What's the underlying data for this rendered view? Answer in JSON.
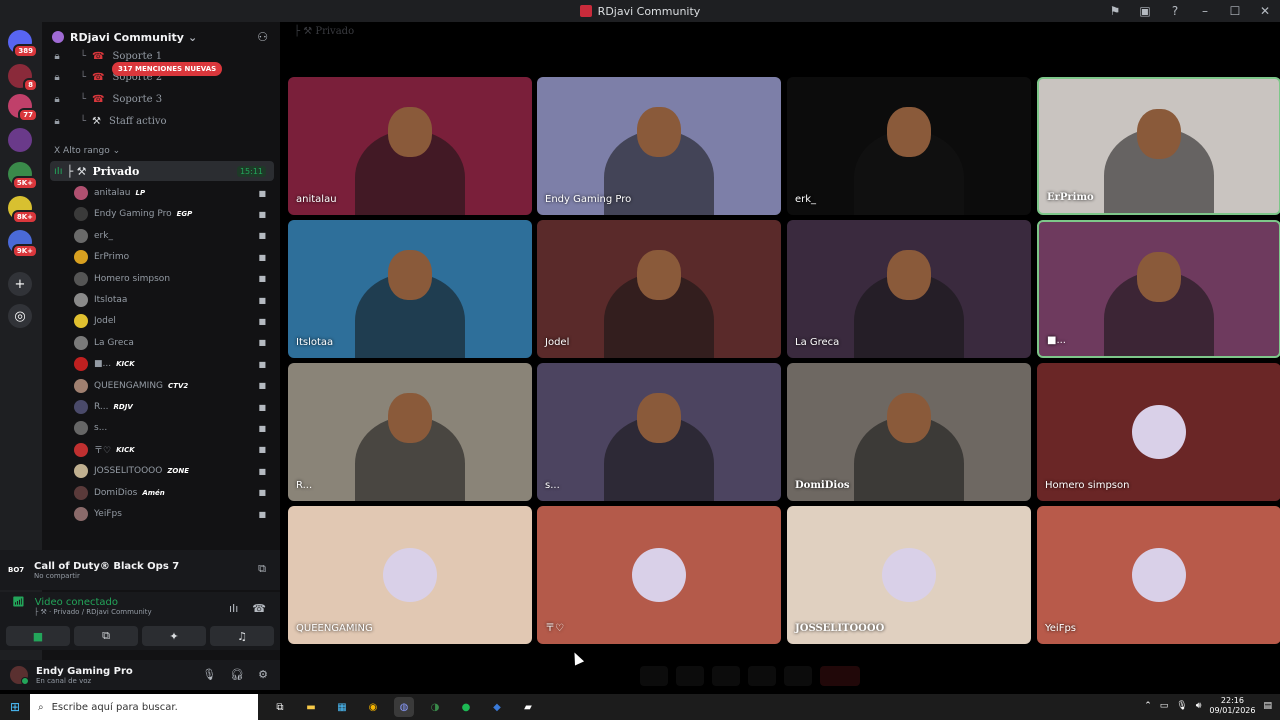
{
  "window": {
    "title": "RDjavi Community"
  },
  "rail": {
    "badges": [
      "389",
      "8",
      "77",
      "5K+",
      "8K+",
      "9K+"
    ]
  },
  "server": {
    "name": "RDjavi Community",
    "mentions_banner": "317 MENCIONES NUEVAS"
  },
  "channels": [
    {
      "label": "Soporte 1"
    },
    {
      "label": "Soporte 2"
    },
    {
      "label": "Soporte 3"
    },
    {
      "label": "Staff activo"
    }
  ],
  "category": "Alto rango",
  "active_channel": {
    "name": "Privado",
    "time": "15:11"
  },
  "members": [
    {
      "name": "anitalau",
      "tag": "LP"
    },
    {
      "name": "Endy Gaming Pro",
      "tag": "EGP"
    },
    {
      "name": "erk_",
      "tag": ""
    },
    {
      "name": "ErPrimo",
      "tag": ""
    },
    {
      "name": "Homero simpson",
      "tag": ""
    },
    {
      "name": "Itslotaa",
      "tag": ""
    },
    {
      "name": "Jodel",
      "tag": ""
    },
    {
      "name": "La Greca",
      "tag": ""
    },
    {
      "name": "■...",
      "tag": "KICK"
    },
    {
      "name": "QUEENGAMING",
      "tag": "CTV2"
    },
    {
      "name": "R...",
      "tag": "RDJV"
    },
    {
      "name": "s...",
      "tag": ""
    },
    {
      "name": "〒♡",
      "tag": "KICK"
    },
    {
      "name": "JOSSELITOOOO",
      "tag": "ZONE"
    },
    {
      "name": "DomiDios",
      "tag": "Amén"
    },
    {
      "name": "YeiFps",
      "tag": ""
    }
  ],
  "activity": {
    "game_icon": "BO7",
    "game": "Call of Duty® Black Ops 7",
    "sub": "No compartir"
  },
  "voice": {
    "status": "Video conectado",
    "channel": "Privado / RDjavi Community"
  },
  "user": {
    "name": "Endy Gaming Pro",
    "status": "En canal de voz"
  },
  "main": {
    "header": "Privado"
  },
  "tiles": [
    {
      "label": "anitalau",
      "bg": "#7a1f3a"
    },
    {
      "label": "Endy Gaming Pro",
      "bg": "#7d7fa8"
    },
    {
      "label": "erk_",
      "bg": "#0c0c0c"
    },
    {
      "label": "ErPrimo",
      "bg": "#c9c4c0"
    },
    {
      "label": "Itslotaa",
      "bg": "#2e6f9a"
    },
    {
      "label": "Jodel",
      "bg": "#5a2a2a"
    },
    {
      "label": "La Greca",
      "bg": "#3a2a3e"
    },
    {
      "label": "■...",
      "bg": "#6e3a5e"
    },
    {
      "label": "R...",
      "bg": "#8a8478"
    },
    {
      "label": "s...",
      "bg": "#4c4460"
    },
    {
      "label": "DomiDios",
      "bg": "#6e6862"
    },
    {
      "label": "Homero simpson",
      "bg": "#6a2626"
    },
    {
      "label": "QUEENGAMING",
      "bg": "#e1c8b3"
    },
    {
      "label": "〒♡",
      "bg": "#b45a4a"
    },
    {
      "label": "JOSSELITOOOO",
      "bg": "#e0d0c0"
    },
    {
      "label": "YeiFps",
      "bg": "#b85a4a"
    }
  ],
  "taskbar": {
    "search_placeholder": "Escribe aquí para buscar.",
    "time": "22:16",
    "date": "09/01/2026"
  }
}
